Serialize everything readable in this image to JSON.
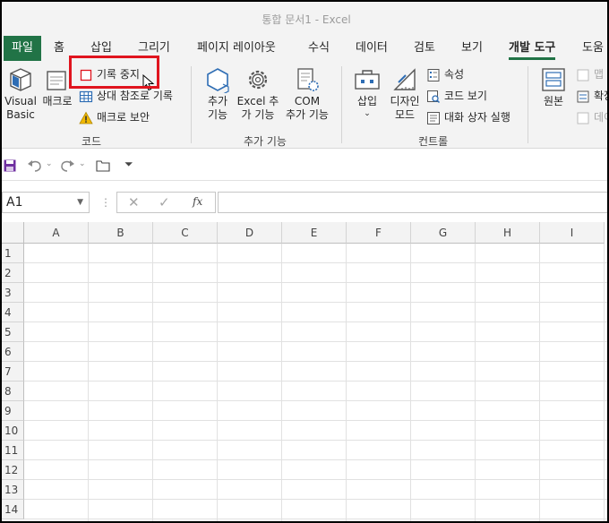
{
  "title": "통합 문서1  -  Excel",
  "tabs": [
    {
      "label": "파일"
    },
    {
      "label": "홈"
    },
    {
      "label": "삽입"
    },
    {
      "label": "그리기"
    },
    {
      "label": "페이지 레이아웃"
    },
    {
      "label": "수식"
    },
    {
      "label": "데이터"
    },
    {
      "label": "검토"
    },
    {
      "label": "보기"
    },
    {
      "label": "개발 도구"
    },
    {
      "label": "도움"
    }
  ],
  "ribbon": {
    "code": {
      "group_label": "코드",
      "visual_basic_line1": "Visual",
      "visual_basic_line2": "Basic",
      "macro": "매크로",
      "stop_recording": "기록 중지",
      "relative_ref": "상대 참조로 기록",
      "macro_security": "매크로 보안"
    },
    "addins": {
      "group_label": "추가 기능",
      "addins_line1": "추가",
      "addins_line2": "기능",
      "excel_addins_line1": "Excel 추",
      "excel_addins_line2": "가 기능",
      "com_addins_line1": "COM",
      "com_addins_line2": "추가 기능"
    },
    "controls": {
      "group_label": "컨트롤",
      "insert": "삽입",
      "design_mode_line1": "디자인",
      "design_mode_line2": "모드",
      "properties": "속성",
      "view_code": "코드 보기",
      "run_dialog": "대화 상자 실행"
    },
    "xml": {
      "source": "원본",
      "map": "맵",
      "expand": "확장",
      "data": "데이"
    }
  },
  "formula_bar": {
    "name_box": "A1",
    "fx": "fx",
    "formula": ""
  },
  "grid": {
    "columns": [
      "A",
      "B",
      "C",
      "D",
      "E",
      "F",
      "G",
      "H",
      "I"
    ],
    "rows": [
      "1",
      "2",
      "3",
      "4",
      "5",
      "6",
      "7",
      "8",
      "9",
      "10",
      "11",
      "12",
      "13",
      "14"
    ]
  },
  "colors": {
    "accent": "#217346",
    "highlight": "#e0141e"
  }
}
